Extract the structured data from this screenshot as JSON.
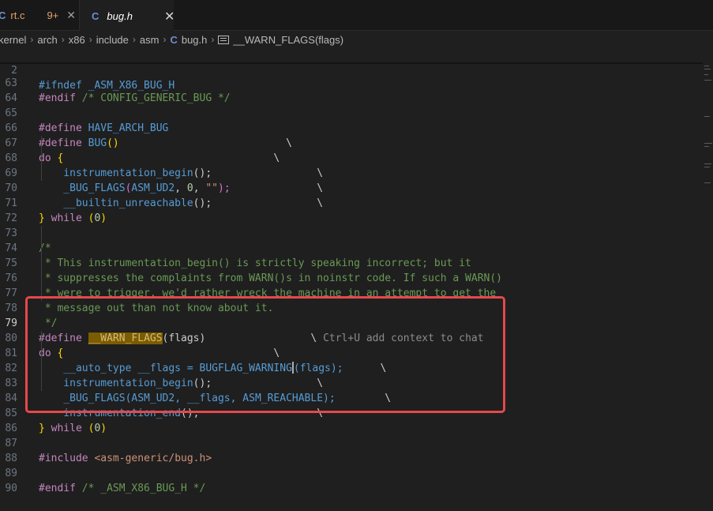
{
  "tabs": [
    {
      "icon": "C",
      "name": "rt.c",
      "badge": "9+",
      "close": "✕"
    },
    {
      "icon": "C",
      "name": "bug.h",
      "close": "✕"
    }
  ],
  "breadcrumb": [
    "kernel",
    "arch",
    "x86",
    "include",
    "asm",
    "bug.h",
    "__WARN_FLAGS(flags)"
  ],
  "breadcrumb_c_icon": "C",
  "sticky": {
    "ln": "2",
    "text": "#ifndef _ASM_X86_BUG_H"
  },
  "lines": {
    "l63": {
      "ln": "63",
      "a": "#endif",
      "b": " /* CONFIG_GENERIC_BUG */"
    },
    "l64": {
      "ln": "64"
    },
    "l65": {
      "ln": "65",
      "a": "#define",
      "b": " HAVE_ARCH_BUG"
    },
    "l66": {
      "ln": "66",
      "a": "#define",
      "b": " BUG",
      "c": "()",
      "d": "                           \\"
    },
    "l67": {
      "ln": "67",
      "a": "do",
      "b": " ",
      "c": "{",
      "d": "                                  \\"
    },
    "l68": {
      "ln": "68",
      "a": "    instrumentation_begin",
      "b": "();",
      "c": "                 \\"
    },
    "l69": {
      "ln": "69",
      "a": "    _BUG_FLAGS",
      "b": "(",
      "c": "ASM_UD2",
      "d": ", ",
      "e": "0",
      "f": ", ",
      "g": "\"\"",
      "h": ");",
      "i": "              \\"
    },
    "l70": {
      "ln": "70",
      "a": "    __builtin_unreachable",
      "b": "();",
      "c": "                 \\"
    },
    "l71": {
      "ln": "71",
      "a": "}",
      "b": " ",
      "c": "while",
      "d": " (",
      "e": "0",
      "f": ")"
    },
    "l72": {
      "ln": "72"
    },
    "l73": {
      "ln": "73",
      "a": "/*"
    },
    "l74": {
      "ln": "74",
      "a": " * This instrumentation_begin() is strictly speaking incorrect; but it"
    },
    "l75": {
      "ln": "75",
      "a": " * suppresses the complaints from WARN()s in noinstr code. If such a WARN()"
    },
    "l76": {
      "ln": "76",
      "a": " * were to trigger, we'd rather wreck the machine in an attempt to get the"
    },
    "l77": {
      "ln": "77",
      "a": " * message out than not know about it."
    },
    "l78": {
      "ln": "78",
      "a": " */"
    },
    "l79": {
      "ln": "79",
      "a": "#define",
      "b": " ",
      "c": "__WARN_FLAGS",
      "d": "(flags)",
      "e": "                 \\ ",
      "f": "Ctrl+U add context to chat"
    },
    "l80": {
      "ln": "80",
      "a": "do",
      "b": " ",
      "c": "{",
      "d": "                                  \\"
    },
    "l81": {
      "ln": "81",
      "a": "    __auto_type __flags = BUGFLAG_WARNING",
      "b": "(flags);",
      "c": "      \\"
    },
    "l82": {
      "ln": "82",
      "a": "    instrumentation_begin",
      "b": "();",
      "c": "                 \\"
    },
    "l83": {
      "ln": "83",
      "a": "    _BUG_FLAGS",
      "b": "(ASM_UD2, __flags, ASM_REACHABLE);",
      "c": "        \\"
    },
    "l84": {
      "ln": "84",
      "a": "    instrumentation_end",
      "b": "();",
      "c": "                   \\"
    },
    "l85": {
      "ln": "85",
      "a": "}",
      "b": " ",
      "c": "while",
      "d": " (",
      "e": "0",
      "f": ")"
    },
    "l86": {
      "ln": "86"
    },
    "l87": {
      "ln": "87",
      "a": "#include",
      "b": " <asm-generic/bug.h>"
    },
    "l88": {
      "ln": "88"
    },
    "l89": {
      "ln": "89",
      "a": "#endif",
      "b": " /* _ASM_X86_BUG_H */"
    },
    "l90": {
      "ln": "90"
    }
  },
  "colors": {
    "accent": "#e5484d",
    "highlight": "#7b5c00",
    "keyword": "#c586c0",
    "macro": "#569cd6",
    "comment": "#6a9955"
  }
}
